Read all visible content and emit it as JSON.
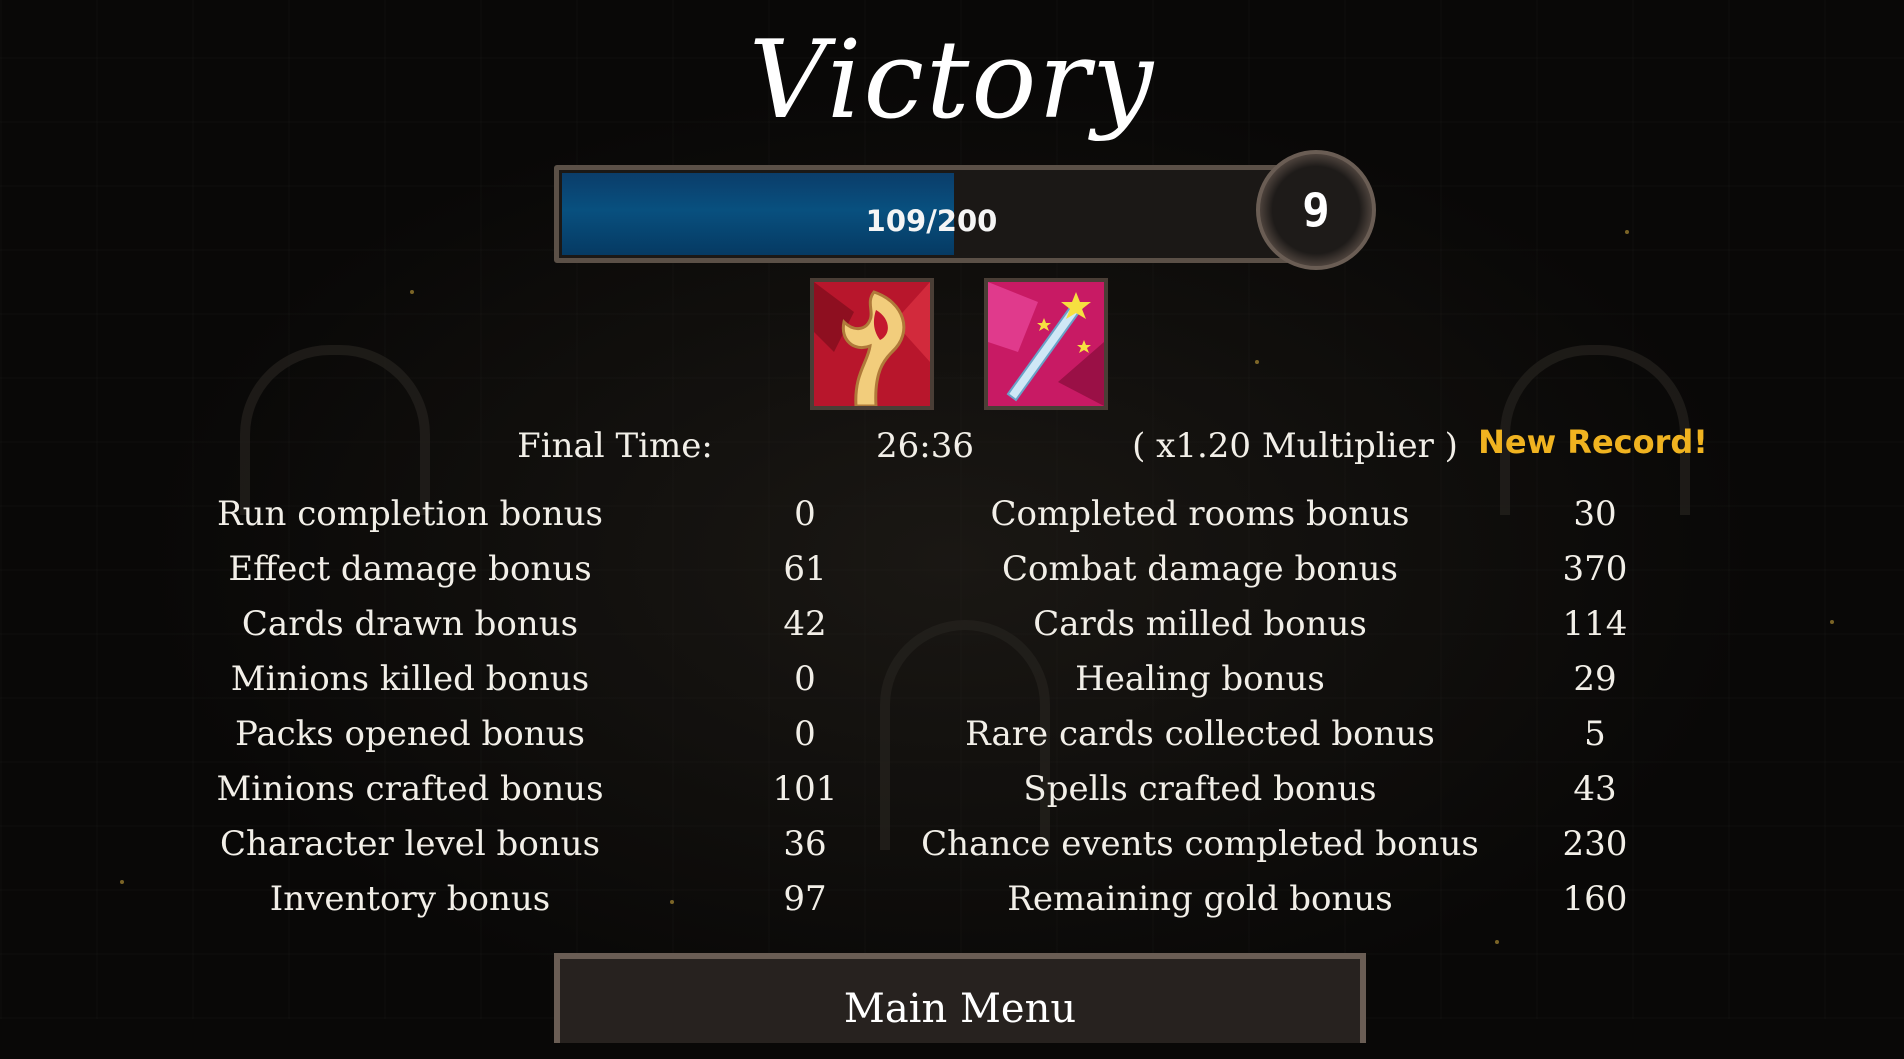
{
  "title": "Victory",
  "xp": {
    "text": "109/200",
    "current": 109,
    "max": 200,
    "fill_color": "#085080"
  },
  "level": {
    "value": "9"
  },
  "relics": [
    {
      "name": "flame-relic-icon",
      "color": "#c4182e"
    },
    {
      "name": "star-wand-relic-icon",
      "color": "#d02a7a"
    }
  ],
  "final_time": {
    "label": "Final Time:",
    "value": "26:36",
    "multiplier": "( x1.20 Multiplier )",
    "record": "New Record!"
  },
  "bonuses": [
    {
      "left_label": "Run completion bonus",
      "left_value": "0",
      "right_label": "Completed rooms bonus",
      "right_value": "30"
    },
    {
      "left_label": "Effect damage bonus",
      "left_value": "61",
      "right_label": "Combat damage bonus",
      "right_value": "370"
    },
    {
      "left_label": "Cards drawn bonus",
      "left_value": "42",
      "right_label": "Cards milled bonus",
      "right_value": "114"
    },
    {
      "left_label": "Minions killed bonus",
      "left_value": "0",
      "right_label": "Healing bonus",
      "right_value": "29"
    },
    {
      "left_label": "Packs opened bonus",
      "left_value": "0",
      "right_label": "Rare cards collected bonus",
      "right_value": "5"
    },
    {
      "left_label": "Minions crafted bonus",
      "left_value": "101",
      "right_label": "Spells crafted bonus",
      "right_value": "43"
    },
    {
      "left_label": "Character level bonus",
      "left_value": "36",
      "right_label": "Chance events completed bonus",
      "right_value": "230"
    },
    {
      "left_label": "Inventory bonus",
      "left_value": "97",
      "right_label": "Remaining gold bonus",
      "right_value": "160"
    }
  ],
  "main_menu_label": "Main Menu",
  "colors": {
    "record": "#f0b320",
    "text": "#f2efe8",
    "background": "#090807"
  }
}
